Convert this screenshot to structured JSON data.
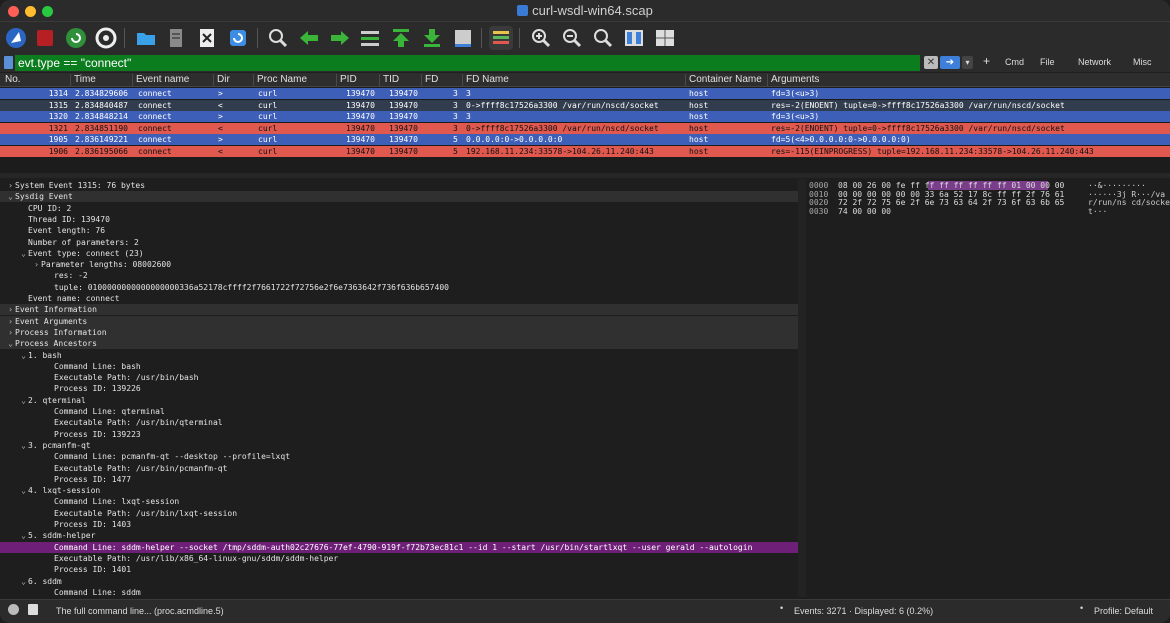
{
  "window": {
    "title": "curl-wsdl-win64.scap"
  },
  "colors": {
    "filter_ok": "#0b7d1f",
    "row_blue": "#3e5fb8",
    "row_red": "#e0584e",
    "row_selected": "#313c4e",
    "highlight": "#6e1f77"
  },
  "toolbar": {
    "icons": [
      "shark-fin-start-icon",
      "stop-capture-icon",
      "restart-capture-icon",
      "capture-options-icon",
      "open-folder-icon",
      "save-file-icon",
      "close-file-icon",
      "reload-icon",
      "find-packet-icon",
      "go-back-icon",
      "go-forward-icon",
      "go-to-packet-icon",
      "first-packet-icon",
      "last-packet-icon",
      "autoscroll-icon",
      "colorize-icon",
      "zoom-in-icon",
      "zoom-out-icon",
      "normal-size-icon",
      "resize-columns-icon",
      "grid-icon"
    ]
  },
  "filter": {
    "value": "evt.type == \"connect\"",
    "buttons": {
      "plus": "+",
      "cmd": "Cmd",
      "file": "File",
      "network": "Network",
      "misc": "Misc"
    }
  },
  "columns": [
    "No.",
    "Time",
    "Event name",
    "Dir",
    "Proc Name",
    "PID",
    "TID",
    "FD",
    "FD Name",
    "Container Name",
    "Arguments"
  ],
  "rows": [
    {
      "no": "1314",
      "time": "2.834829606",
      "event": "connect",
      "dir": ">",
      "proc": "curl",
      "pid": "139470",
      "tid": "139470",
      "fd": "3",
      "fdname": "3",
      "container": "host",
      "args": "fd=3(<u>3)",
      "style": "blue"
    },
    {
      "no": "1315",
      "time": "2.834840487",
      "event": "connect",
      "dir": "<",
      "proc": "curl",
      "pid": "139470",
      "tid": "139470",
      "fd": "3",
      "fdname": "0->ffff8c17526a3300 /var/run/nscd/socket",
      "container": "host",
      "args": "res=-2(ENOENT) tuple=0->ffff8c17526a3300 /var/run/nscd/socket",
      "style": "selected"
    },
    {
      "no": "1320",
      "time": "2.834848214",
      "event": "connect",
      "dir": ">",
      "proc": "curl",
      "pid": "139470",
      "tid": "139470",
      "fd": "3",
      "fdname": "3",
      "container": "host",
      "args": "fd=3(<u>3)",
      "style": "blue"
    },
    {
      "no": "1321",
      "time": "2.834851190",
      "event": "connect",
      "dir": "<",
      "proc": "curl",
      "pid": "139470",
      "tid": "139470",
      "fd": "3",
      "fdname": "0->ffff8c17526a3300 /var/run/nscd/socket",
      "container": "host",
      "args": "res=-2(ENOENT) tuple=0->ffff8c17526a3300 /var/run/nscd/socket",
      "style": "red"
    },
    {
      "no": "1905",
      "time": "2.836149221",
      "event": "connect",
      "dir": ">",
      "proc": "curl",
      "pid": "139470",
      "tid": "139470",
      "fd": "5",
      "fdname": "0.0.0.0:0->0.0.0.0:0",
      "container": "host",
      "args": "fd=5(<4>0.0.0.0:0->0.0.0.0:0)",
      "style": "blue"
    },
    {
      "no": "1906",
      "time": "2.836195066",
      "event": "connect",
      "dir": "<",
      "proc": "curl",
      "pid": "139470",
      "tid": "139470",
      "fd": "5",
      "fdname": "192.168.11.234:33578->104.26.11.240:443",
      "container": "host",
      "args": "res=-115(EINPROGRESS) tuple=192.168.11.234:33578->104.26.11.240:443",
      "style": "red"
    }
  ],
  "details": [
    {
      "indent": 0,
      "arrow": ">",
      "text": "System Event 1315: 76 bytes",
      "style": ""
    },
    {
      "indent": 0,
      "arrow": "v",
      "text": "Sysdig Event",
      "style": "sec"
    },
    {
      "indent": 1,
      "arrow": "",
      "text": "CPU ID: 2",
      "style": ""
    },
    {
      "indent": 1,
      "arrow": "",
      "text": "Thread ID: 139470",
      "style": ""
    },
    {
      "indent": 1,
      "arrow": "",
      "text": "Event length: 76",
      "style": ""
    },
    {
      "indent": 1,
      "arrow": "",
      "text": "Number of parameters: 2",
      "style": ""
    },
    {
      "indent": 1,
      "arrow": "v",
      "text": "Event type: connect (23)",
      "style": ""
    },
    {
      "indent": 2,
      "arrow": ">",
      "text": "Parameter lengths: 08002600",
      "style": ""
    },
    {
      "indent": 3,
      "arrow": "",
      "text": "res: -2",
      "style": ""
    },
    {
      "indent": 3,
      "arrow": "",
      "text": "tuple: 0100000000000000000336a52178cffff2f7661722f72756e2f6e7363642f736f636b657400",
      "style": ""
    },
    {
      "indent": 1,
      "arrow": "",
      "text": "Event name: connect",
      "style": ""
    },
    {
      "indent": 0,
      "arrow": ">",
      "text": "Event Information",
      "style": "sec"
    },
    {
      "indent": 0,
      "arrow": ">",
      "text": "Event Arguments",
      "style": "sec"
    },
    {
      "indent": 0,
      "arrow": ">",
      "text": "Process Information",
      "style": "sec"
    },
    {
      "indent": 0,
      "arrow": "v",
      "text": "Process Ancestors",
      "style": "sec"
    },
    {
      "indent": 1,
      "arrow": "v",
      "text": "1. bash",
      "style": ""
    },
    {
      "indent": 3,
      "arrow": "",
      "text": "Command Line: bash",
      "style": ""
    },
    {
      "indent": 3,
      "arrow": "",
      "text": "Executable Path: /usr/bin/bash",
      "style": ""
    },
    {
      "indent": 3,
      "arrow": "",
      "text": "Process ID: 139226",
      "style": ""
    },
    {
      "indent": 1,
      "arrow": "v",
      "text": "2. qterminal",
      "style": ""
    },
    {
      "indent": 3,
      "arrow": "",
      "text": "Command Line: qterminal",
      "style": ""
    },
    {
      "indent": 3,
      "arrow": "",
      "text": "Executable Path: /usr/bin/qterminal",
      "style": ""
    },
    {
      "indent": 3,
      "arrow": "",
      "text": "Process ID: 139223",
      "style": ""
    },
    {
      "indent": 1,
      "arrow": "v",
      "text": "3. pcmanfm-qt",
      "style": ""
    },
    {
      "indent": 3,
      "arrow": "",
      "text": "Command Line: pcmanfm-qt --desktop --profile=lxqt",
      "style": ""
    },
    {
      "indent": 3,
      "arrow": "",
      "text": "Executable Path: /usr/bin/pcmanfm-qt",
      "style": ""
    },
    {
      "indent": 3,
      "arrow": "",
      "text": "Process ID: 1477",
      "style": ""
    },
    {
      "indent": 1,
      "arrow": "v",
      "text": "4. lxqt-session",
      "style": ""
    },
    {
      "indent": 3,
      "arrow": "",
      "text": "Command Line: lxqt-session",
      "style": ""
    },
    {
      "indent": 3,
      "arrow": "",
      "text": "Executable Path: /usr/bin/lxqt-session",
      "style": ""
    },
    {
      "indent": 3,
      "arrow": "",
      "text": "Process ID: 1403",
      "style": ""
    },
    {
      "indent": 1,
      "arrow": "v",
      "text": "5. sddm-helper",
      "style": ""
    },
    {
      "indent": 3,
      "arrow": "",
      "text": "Command Line: sddm-helper --socket /tmp/sddm-auth02c27676-77ef-4790-919f-f72b73ec81c1 --id 1 --start /usr/bin/startlxqt --user gerald --autologin",
      "style": "hl"
    },
    {
      "indent": 3,
      "arrow": "",
      "text": "Executable Path: /usr/lib/x86_64-linux-gnu/sddm/sddm-helper",
      "style": ""
    },
    {
      "indent": 3,
      "arrow": "",
      "text": "Process ID: 1401",
      "style": ""
    },
    {
      "indent": 1,
      "arrow": "v",
      "text": "6. sddm",
      "style": ""
    },
    {
      "indent": 3,
      "arrow": "",
      "text": "Command Line: sddm",
      "style": ""
    }
  ],
  "hex": [
    {
      "off": "0000",
      "bytes": "08 00 26 00 fe ff ff ff  ff ff ff ff 01 00 00 00",
      "ascii": "··&·········"
    },
    {
      "off": "0010",
      "bytes": "00 00 00 00 00 00 33 6a  52 17 8c ff ff 2f 76 61",
      "ascii": "······3j R···/va"
    },
    {
      "off": "0020",
      "bytes": "72 2f 72 75 6e 2f 6e 73  63 64 2f 73 6f 63 6b 65",
      "ascii": "r/run/ns cd/socke"
    },
    {
      "off": "0030",
      "bytes": "74 00 00 00",
      "ascii": "t···"
    }
  ],
  "status": {
    "message": "The full command line... (proc.acmdline.5)",
    "events": "Events: 3271 · Displayed: 6 (0.2%)",
    "profile": "Profile: Default"
  }
}
